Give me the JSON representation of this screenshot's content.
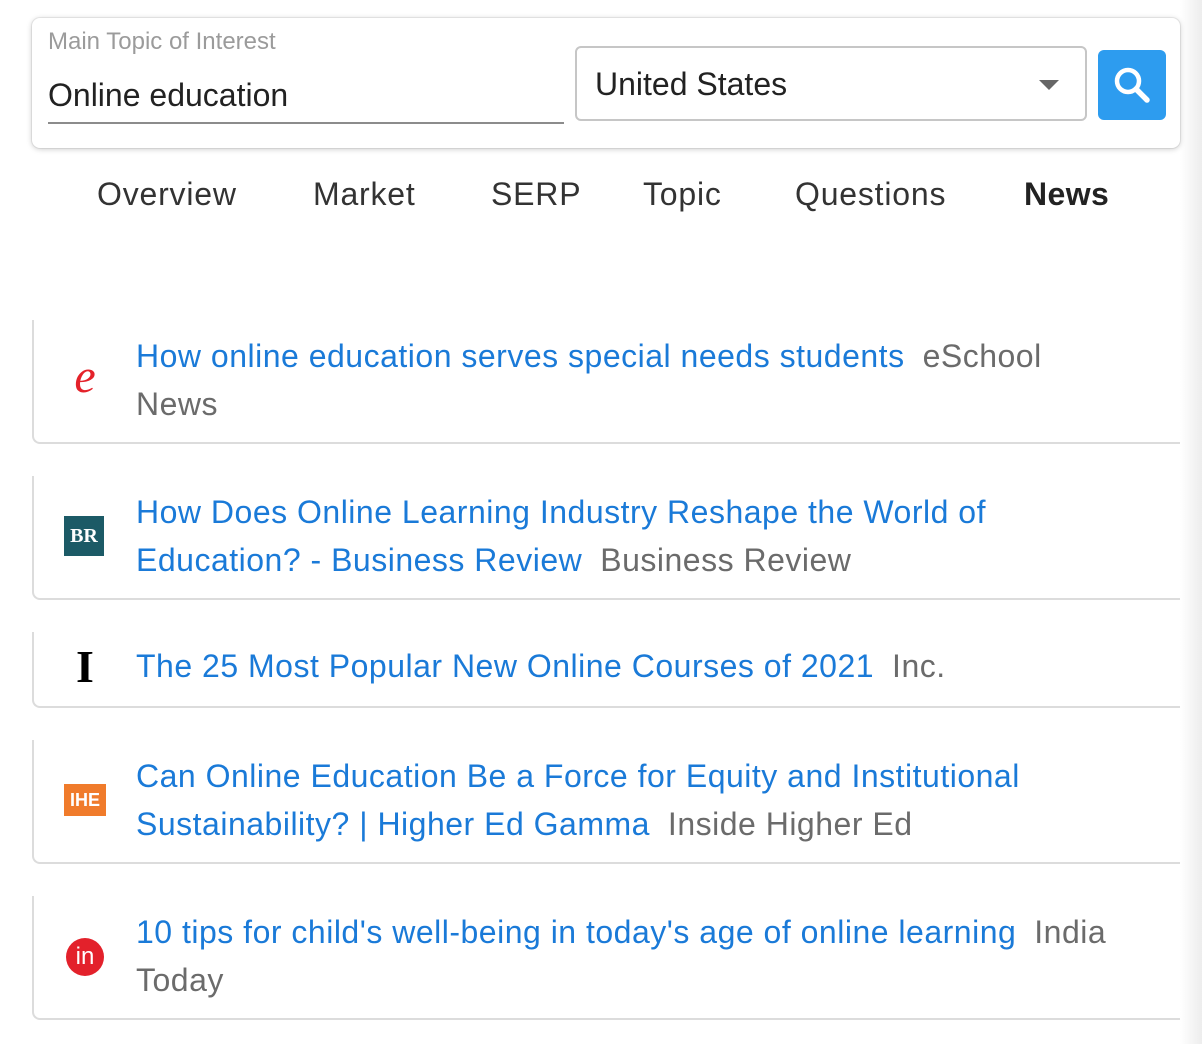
{
  "search": {
    "topic_label": "Main Topic of Interest",
    "topic_value": "Online education",
    "country_value": "United States",
    "search_icon": "search-icon",
    "accent_color": "#2d9cef"
  },
  "tabs": [
    {
      "label": "Overview",
      "active": false
    },
    {
      "label": "Market",
      "active": false
    },
    {
      "label": "SERP",
      "active": false
    },
    {
      "label": "Topic",
      "active": false
    },
    {
      "label": "Questions",
      "active": false
    },
    {
      "label": "News",
      "active": true
    }
  ],
  "news": [
    {
      "logo": "eschool-news-logo",
      "logo_text": "e",
      "title": "How online education serves special needs students",
      "source": "eSchool News"
    },
    {
      "logo": "business-review-logo",
      "logo_text": "BR",
      "title": "How Does Online Learning Industry Reshape the World of Education? - Business Review",
      "source": "Business Review"
    },
    {
      "logo": "inc-logo",
      "logo_text": "I",
      "title": "The 25 Most Popular New Online Courses of 2021",
      "source": "Inc."
    },
    {
      "logo": "inside-higher-ed-logo",
      "logo_text": "IHE",
      "title": "Can Online Education Be a Force for Equity and Institutional Sustainability? | Higher Ed Gamma",
      "source": "Inside Higher Ed"
    },
    {
      "logo": "india-today-logo",
      "logo_text": "in",
      "title": "10 tips for child's well-being in today's age of online learning",
      "source": "India Today"
    }
  ]
}
